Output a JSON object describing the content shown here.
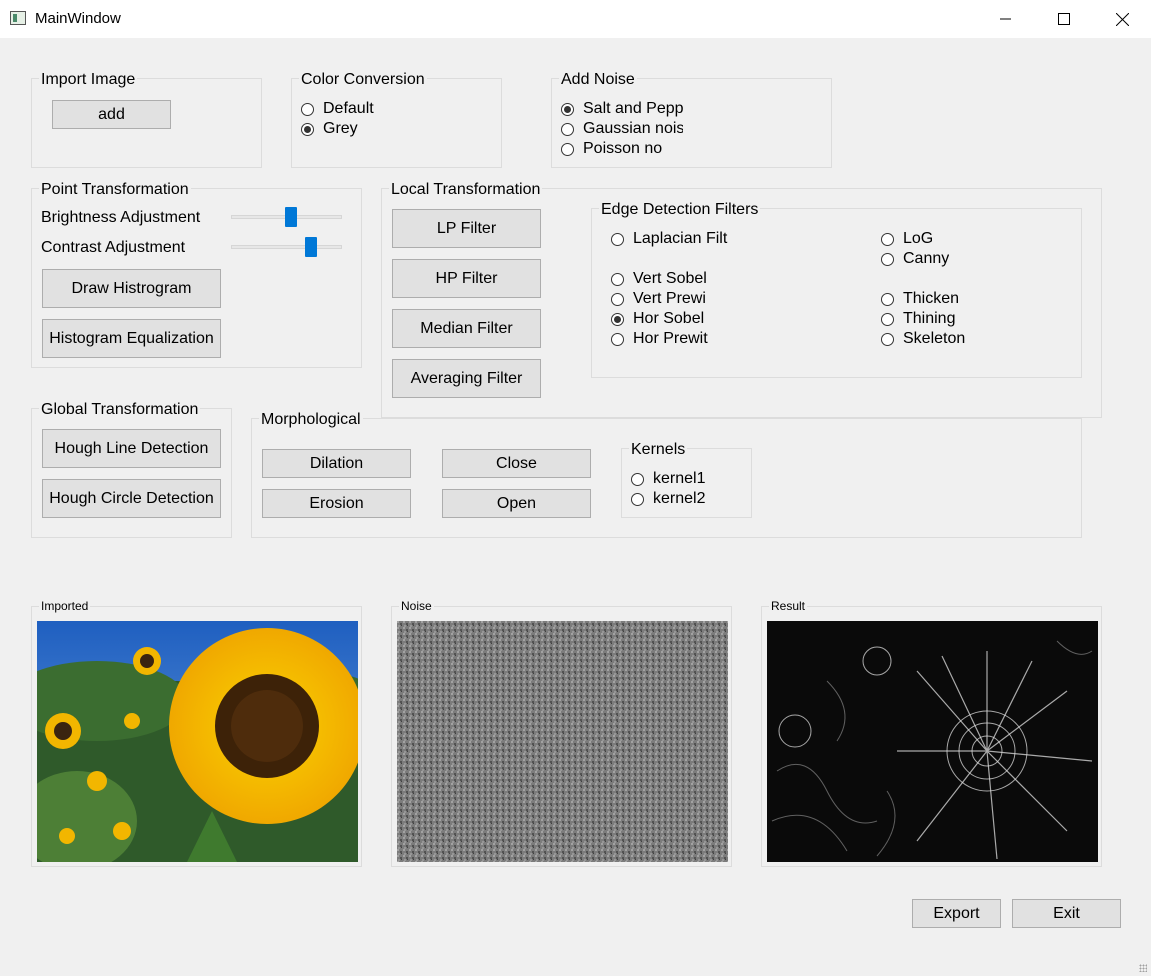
{
  "window": {
    "title": "MainWindow",
    "minimize_icon": "minimize-icon",
    "maximize_icon": "maximize-icon",
    "close_icon": "close-icon"
  },
  "import_image": {
    "title": "Import Image",
    "add_label": "add"
  },
  "color_conversion": {
    "title": "Color Conversion",
    "options": [
      "Default",
      "Grey"
    ],
    "selected": "Grey"
  },
  "add_noise": {
    "title": "Add Noise",
    "options": [
      "Salt and Pepp",
      "Gaussian nois",
      "Poisson no"
    ],
    "selected": "Salt and Pepp"
  },
  "point_transformation": {
    "title": "Point Transformation",
    "brightness_label": "Brightness Adjustment",
    "brightness_value": 0.55,
    "contrast_label": "Contrast Adjustment",
    "contrast_value": 0.75,
    "draw_histogram_label": "Draw Histrogram",
    "histogram_equalization_label": "Histogram Equalization"
  },
  "local_transformation": {
    "title": "Local Transformation",
    "buttons": [
      "LP Filter",
      "HP Filter",
      "Median Filter",
      "Averaging Filter"
    ]
  },
  "edge_detection": {
    "title": "Edge Detection Filters",
    "options": [
      "Laplacian Filt",
      "Vert Sobel",
      "Vert Prewi",
      "Hor Sobel",
      "Hor Prewit",
      "LoG",
      "Canny",
      "Thicken",
      "Thining",
      "Skeleton"
    ],
    "selected": "Hor Sobel"
  },
  "global_transformation": {
    "title": "Global Transformation",
    "hough_line_label": "Hough Line Detection",
    "hough_circle_label": "Hough Circle Detection"
  },
  "morphological": {
    "title": "Morphological",
    "dilation_label": "Dilation",
    "close_label": "Close",
    "erosion_label": "Erosion",
    "open_label": "Open",
    "kernels": {
      "title": "Kernels",
      "options": [
        "kernel1",
        "kernel2"
      ],
      "selected": ""
    }
  },
  "panels": {
    "imported": "Imported",
    "noise": "Noise",
    "result": "Result"
  },
  "footer": {
    "export_label": "Export",
    "exit_label": "Exit"
  },
  "colors": {
    "accent": "#0078d7",
    "background": "#f0f0f0",
    "button": "#e1e1e1"
  }
}
